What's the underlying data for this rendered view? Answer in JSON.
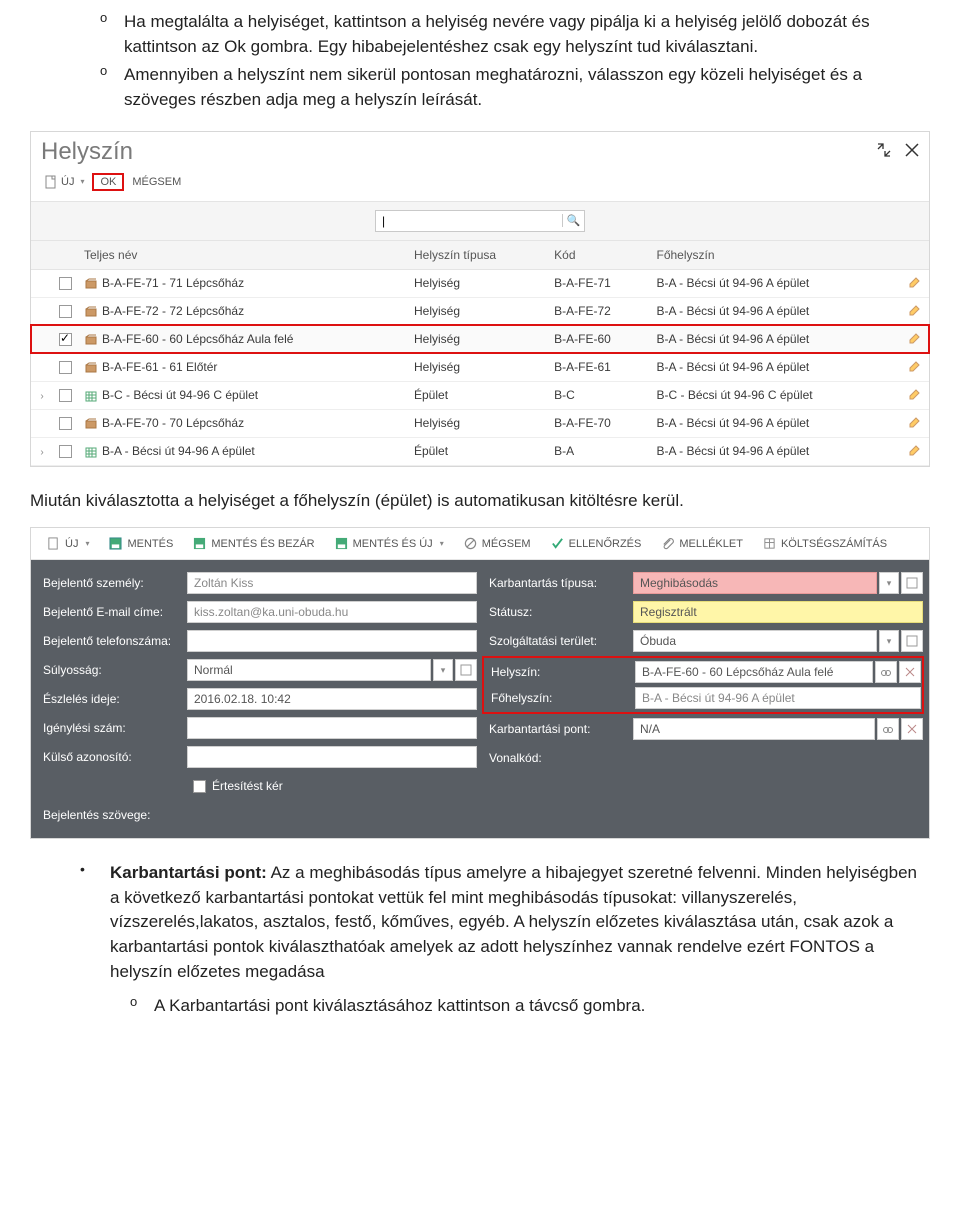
{
  "bullets_top": [
    "Ha megtalálta a helyiséget, kattintson a helyiség nevére vagy pipálja ki a helyiség jelölő dobozát és kattintson az Ok gombra. Egy hibabejelentéshez csak egy helyszínt tud kiválasztani.",
    "Amennyiben a helyszínt nem sikerül pontosan meghatározni, válasszon egy közeli helyiséget és a szöveges részben adja meg a helyszín leírását."
  ],
  "shot1": {
    "title": "Helyszín",
    "toolbar": {
      "new": "ÚJ",
      "ok": "OK",
      "cancel": "MÉGSEM"
    },
    "search_value": "|",
    "columns": {
      "name": "Teljes név",
      "type": "Helyszín típusa",
      "code": "Kód",
      "main": "Főhelyszín"
    },
    "rows": [
      {
        "exp": "",
        "chk": false,
        "icon": "room",
        "name": "B-A-FE-71 - 71 Lépcsőház",
        "type": "Helyiség",
        "code": "B-A-FE-71",
        "main": "B-A - Bécsi út 94-96 A épület"
      },
      {
        "exp": "",
        "chk": false,
        "icon": "room",
        "name": "B-A-FE-72 - 72 Lépcsőház",
        "type": "Helyiség",
        "code": "B-A-FE-72",
        "main": "B-A - Bécsi út 94-96 A épület"
      },
      {
        "exp": "",
        "chk": true,
        "icon": "room",
        "name": "B-A-FE-60 - 60 Lépcsőház Aula felé",
        "type": "Helyiség",
        "code": "B-A-FE-60",
        "main": "B-A - Bécsi út 94-96 A épület"
      },
      {
        "exp": "",
        "chk": false,
        "icon": "room",
        "name": "B-A-FE-61 - 61 Előtér",
        "type": "Helyiség",
        "code": "B-A-FE-61",
        "main": "B-A - Bécsi út 94-96 A épület"
      },
      {
        "exp": "›",
        "chk": false,
        "icon": "building",
        "name": "B-C - Bécsi út 94-96 C épület",
        "type": "Épület",
        "code": "B-C",
        "main": "B-C - Bécsi út 94-96 C épület"
      },
      {
        "exp": "",
        "chk": false,
        "icon": "room",
        "name": "B-A-FE-70 - 70 Lépcsőház",
        "type": "Helyiség",
        "code": "B-A-FE-70",
        "main": "B-A - Bécsi út 94-96 A épület"
      },
      {
        "exp": "›",
        "chk": false,
        "icon": "building",
        "name": "B-A - Bécsi út 94-96 A épület",
        "type": "Épület",
        "code": "B-A",
        "main": "B-A - Bécsi út 94-96 A épület"
      }
    ]
  },
  "middle_para": "Miután kiválasztotta a helyiséget a főhelyszín (épület) is automatikusan kitöltésre kerül.",
  "shot2": {
    "toolbar": {
      "new": "ÚJ",
      "save": "MENTÉS",
      "saveclose": "MENTÉS ÉS BEZÁR",
      "savenew": "MENTÉS ÉS ÚJ",
      "cancel": "MÉGSEM",
      "check": "ELLENŐRZÉS",
      "attach": "MELLÉKLET",
      "cost": "KÖLTSÉGSZÁMÍTÁS"
    },
    "left": {
      "person_l": "Bejelentő személy:",
      "person_v": "Zoltán Kiss",
      "email_l": "Bejelentő E-mail címe:",
      "email_v": "kiss.zoltan@ka.uni-obuda.hu",
      "phone_l": "Bejelentő telefonszáma:",
      "phone_v": "",
      "sev_l": "Súlyosság:",
      "sev_v": "Normál",
      "detect_l": "Észlelés ideje:",
      "detect_v": "2016.02.18. 10:42",
      "req_l": "Igénylési szám:",
      "req_v": "",
      "ext_l": "Külső azonosító:",
      "ext_v": "",
      "notify": "Értesítést kér"
    },
    "right": {
      "type_l": "Karbantartás típusa:",
      "type_v": "Meghibásodás",
      "status_l": "Státusz:",
      "status_v": "Regisztrált",
      "area_l": "Szolgáltatási terület:",
      "area_v": "Óbuda",
      "loc_l": "Helyszín:",
      "loc_v": "B-A-FE-60 - 60 Lépcsőház Aula felé",
      "mainloc_l": "Főhelyszín:",
      "mainloc_v": "B-A - Bécsi út 94-96 A épület",
      "point_l": "Karbantartási pont:",
      "point_v": "N/A",
      "barcode_l": "Vonalkód:"
    },
    "bottomlabel": "Bejelentés szövege:"
  },
  "final": {
    "bold": "Karbantartási pont:",
    "text": " Az a meghibásodás típus amelyre a hibajegyet szeretné felvenni. Minden helyiségben a következő karbantartási pontokat vettük fel mint meghibásodás típusokat: villanyszerelés, vízszerelés,lakatos, asztalos, festő, kőműves, egyéb. A helyszín előzetes kiválasztása után, csak azok a karbantartási pontok kiválaszthatóak amelyek az adott helyszínhez vannak rendelve ezért FONTOS a helyszín előzetes megadása",
    "sub": "A Karbantartási pont kiválasztásához kattintson a távcső gombra."
  }
}
